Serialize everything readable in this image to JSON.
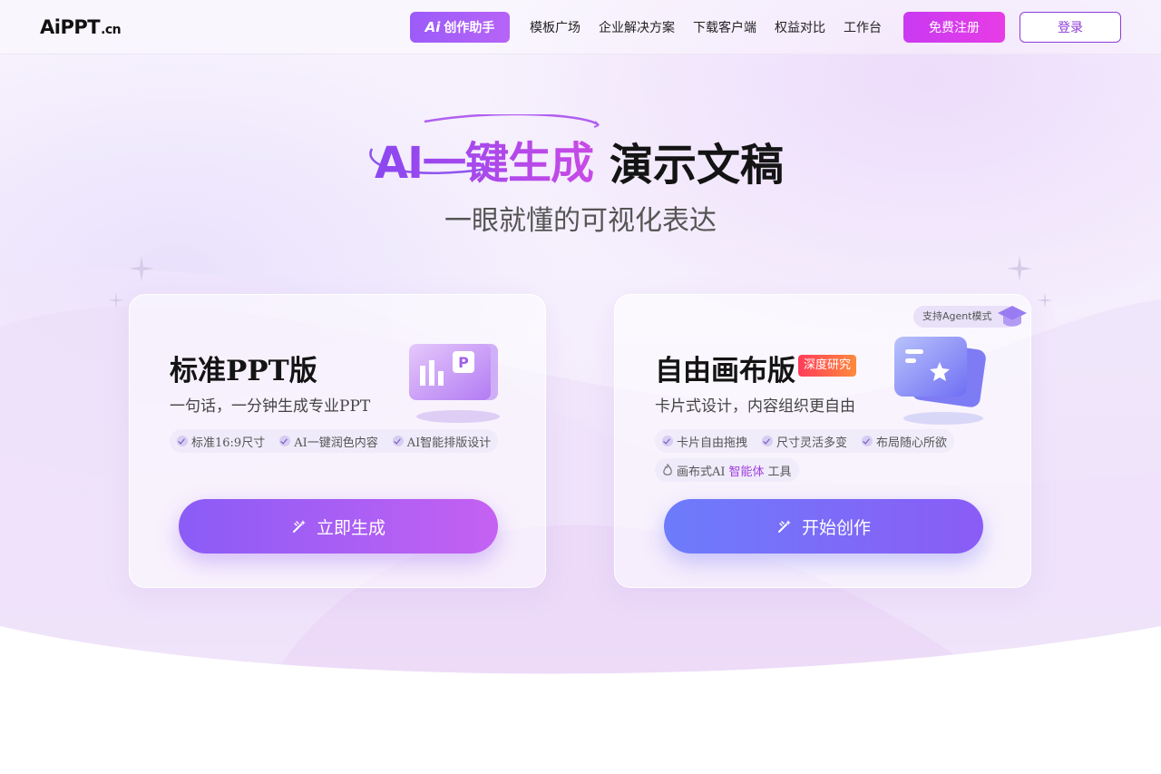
{
  "header": {
    "logo": {
      "main": "AiPPT",
      "suffix": ".cn"
    },
    "ai_assistant_label": "创作助手",
    "ai_assistant_icon": "Ai",
    "nav": [
      "模板广场",
      "企业解决方案",
      "下载客户端",
      "权益对比",
      "工作台"
    ],
    "register_label": "免费注册",
    "login_label": "登录"
  },
  "hero": {
    "title_highlight": "AI一键生成",
    "title_rest": "演示文稿",
    "subtitle": "一眼就懂的可视化表达"
  },
  "cards": [
    {
      "title": "标准PPT版",
      "description": "一句话，一分钟生成专业PPT",
      "features": [
        "标准16:9尺寸",
        "AI一键润色内容",
        "AI智能排版设计"
      ],
      "cta_label": "立即生成",
      "illustration": "ppt-chart-icon"
    },
    {
      "title": "自由画布版",
      "badge": "深度研究",
      "agent_tag": "支持Agent模式",
      "description": "卡片式设计，内容组织更自由",
      "features": [
        "卡片自由拖拽",
        "尺寸灵活多变",
        "布局随心所欲"
      ],
      "extra_feature": {
        "prefix": "画布式AI",
        "highlight": "智能体",
        "suffix": "工具"
      },
      "cta_label": "开始创作",
      "illustration": "card-star-icon"
    }
  ],
  "colors": {
    "brand_purple": "#8b48f0",
    "brand_pink": "#c94ae6",
    "register_gradient": [
      "#c93af2",
      "#e73ce6"
    ],
    "badge_gradient": [
      "#ff3d5a",
      "#ff8a3d"
    ]
  }
}
